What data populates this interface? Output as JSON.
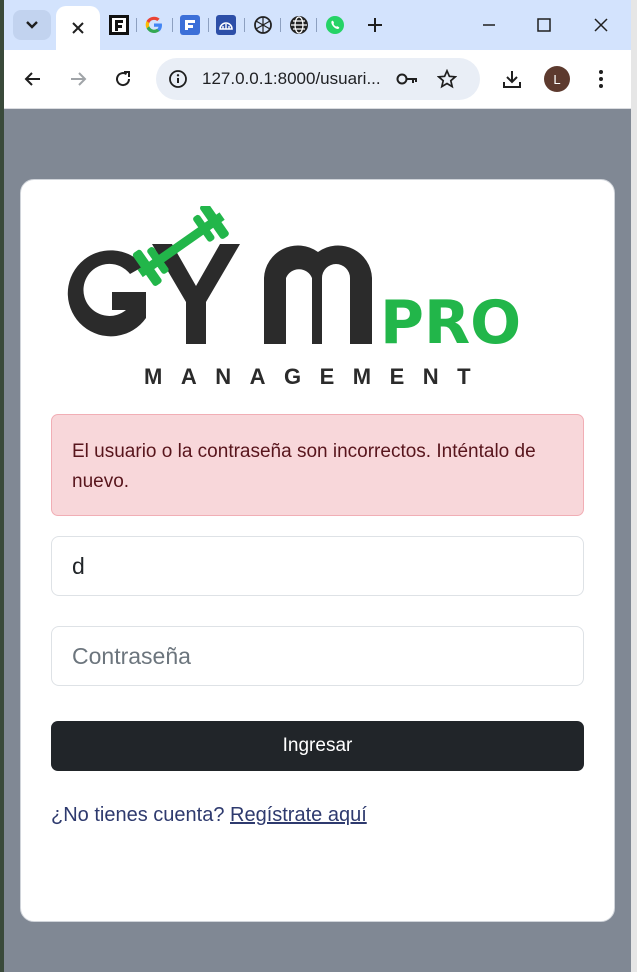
{
  "browser": {
    "url": "127.0.0.1:8000/usuari...",
    "profile_initial": "L",
    "tabs": [
      {
        "icon": "close-icon",
        "active": true
      },
      {
        "icon": "f-favicon"
      },
      {
        "icon": "google-favicon"
      },
      {
        "icon": "form-favicon"
      },
      {
        "icon": "cloud-favicon"
      },
      {
        "icon": "openai-favicon"
      },
      {
        "icon": "globe-favicon"
      },
      {
        "icon": "whatsapp-favicon"
      }
    ]
  },
  "logo": {
    "word": "GYM",
    "pro": "PRO",
    "tagline": "MANAGEMENT",
    "colors": {
      "dark": "#2b2b2b",
      "green": "#22b64a"
    }
  },
  "login": {
    "error_message": "El usuario o la contraseña son incorrectos. Inténtalo de nuevo.",
    "username_value": "d",
    "password_placeholder": "Contraseña",
    "submit_label": "Ingresar",
    "signup_prompt": "¿No tienes cuenta?",
    "signup_link": "Regístrate aquí"
  },
  "colors": {
    "page_bg": "#808894",
    "alert_bg": "#f8d7da",
    "alert_text": "#58151c",
    "button_bg": "#212529"
  }
}
